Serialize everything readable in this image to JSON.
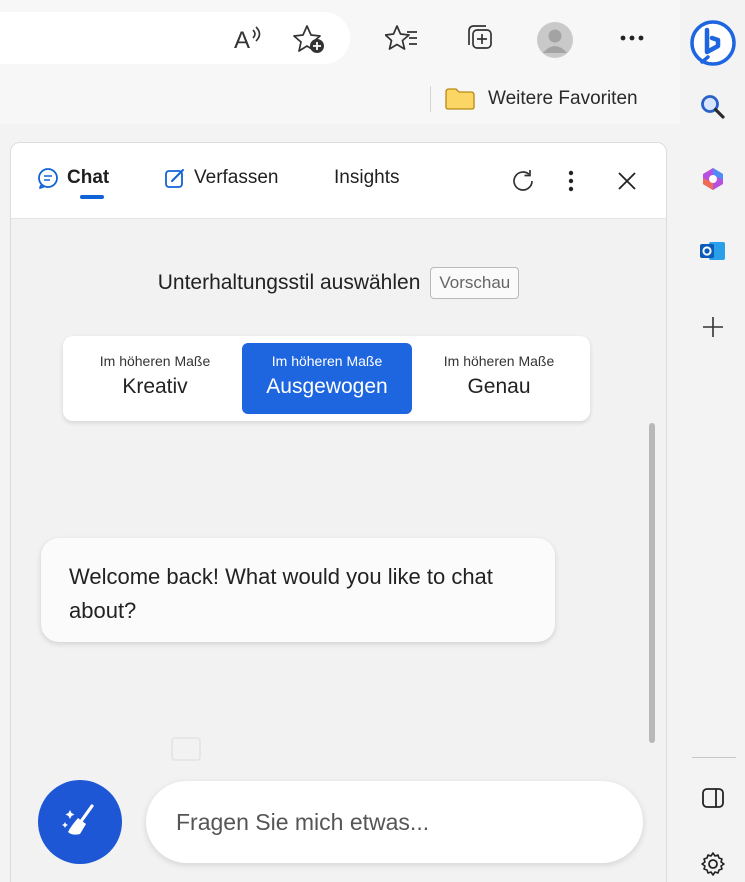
{
  "browser": {
    "favorites_bar": {
      "folder_label": "Weitere Favoriten"
    },
    "toolbar_icons": [
      "read-aloud-icon",
      "add-favorite-icon",
      "favorites-icon",
      "collections-icon",
      "profile-avatar",
      "more-icon"
    ]
  },
  "sidebar_rail": {
    "icons": [
      "bing-copilot-icon",
      "search-icon",
      "office-icon",
      "outlook-icon",
      "add-icon",
      "sidebar-toggle-icon",
      "settings-icon"
    ]
  },
  "panel": {
    "tabs": [
      {
        "label": "Chat",
        "icon": "chat-bubble-icon",
        "active": true
      },
      {
        "label": "Verfassen",
        "icon": "compose-icon",
        "active": false
      },
      {
        "label": "Insights",
        "active": false
      }
    ],
    "conversation_style": {
      "title": "Unterhaltungsstil auswählen",
      "badge": "Vorschau",
      "options": [
        {
          "prefix": "Im höheren Maße",
          "label": "Kreativ",
          "selected": false
        },
        {
          "prefix": "Im höheren Maße",
          "label": "Ausgewogen",
          "selected": true
        },
        {
          "prefix": "Im höheren Maße",
          "label": "Genau",
          "selected": false
        }
      ]
    },
    "message": {
      "text": "Welcome back! What would you like to chat about?"
    },
    "input": {
      "placeholder": "Fragen Sie mich etwas..."
    }
  },
  "colors": {
    "accent": "#1e66e0",
    "new_topic_button": "#1e57d6",
    "tab_underline": "#1063d6"
  }
}
